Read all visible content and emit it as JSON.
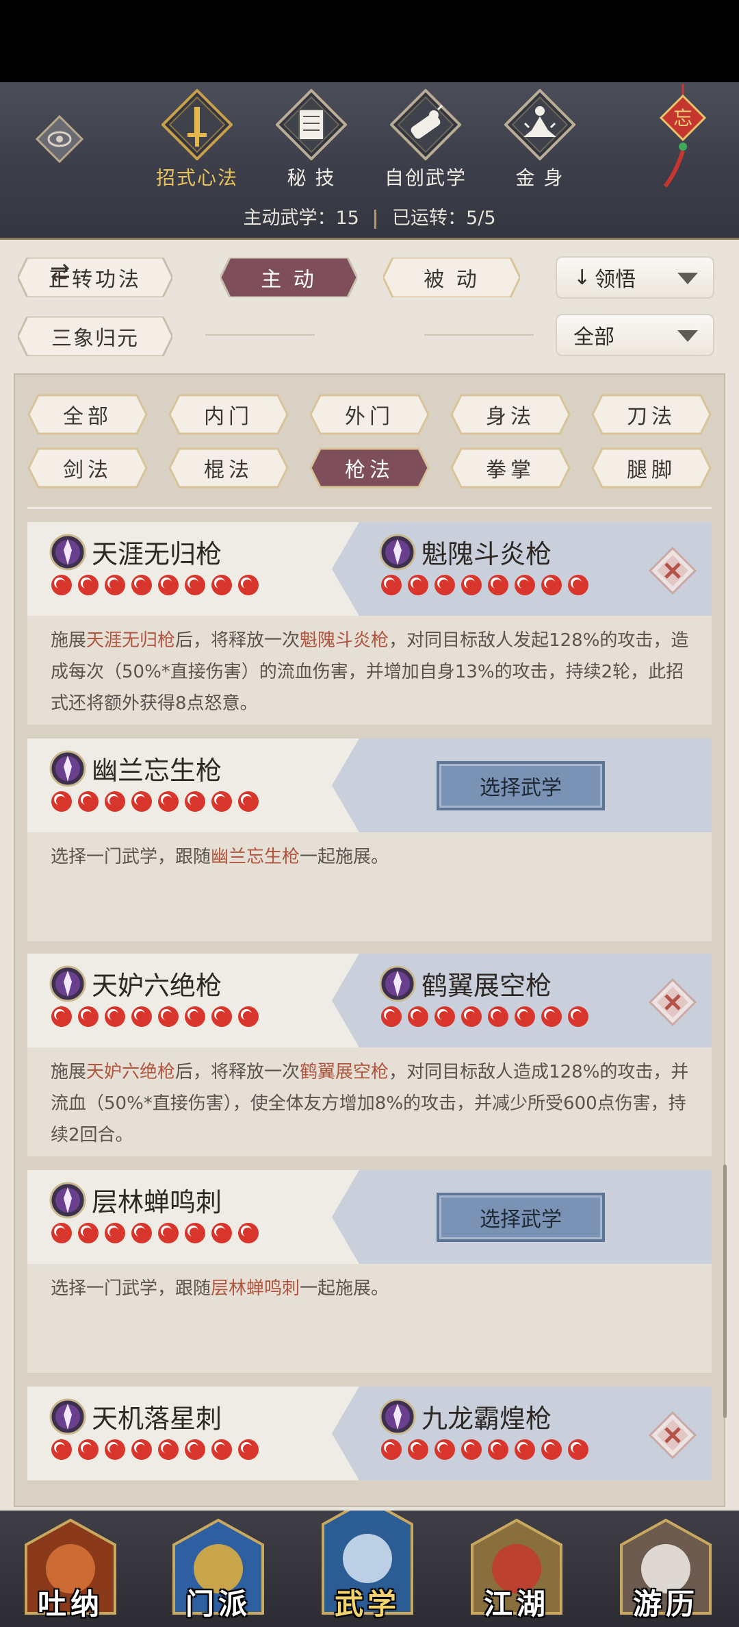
{
  "top_tabs": [
    {
      "label": "招式心法",
      "icon": "sword-icon",
      "active": true
    },
    {
      "label": "秘 技",
      "icon": "book-icon",
      "active": false
    },
    {
      "label": "自创武学",
      "icon": "scroll-icon",
      "active": false
    },
    {
      "label": "金 身",
      "icon": "meditation-icon",
      "active": false
    }
  ],
  "summary": {
    "active_label": "主动武学：15",
    "used_label": "已运转：5/5"
  },
  "filters": {
    "mode_button": "正转功法",
    "active_tab": "主 动",
    "passive_tab": "被 动",
    "sort_dropdown": "领悟",
    "sub_button": "三象归元",
    "scope_dropdown": "全部"
  },
  "types": [
    "全部",
    "内门",
    "外门",
    "身法",
    "刀法",
    "剑法",
    "棍法",
    "枪法",
    "拳掌",
    "腿脚"
  ],
  "active_type": "枪法",
  "cards": [
    {
      "left": "天涯无归枪",
      "right": "魁隗斗炎枪",
      "pips": 8,
      "desc": [
        {
          "t": "施展"
        },
        {
          "t": "天涯无归枪",
          "hl": true
        },
        {
          "t": "后，将释放一次"
        },
        {
          "t": "魁隗斗炎枪",
          "hl": true
        },
        {
          "t": "，对同目标敌人发起128%的攻击，造成每次（50%*直接伤害）的流血伤害，并增加自身13%的攻击，持续2轮，此招式还将额外获得8点怒意。"
        }
      ]
    },
    {
      "left": "幽兰忘生枪",
      "right": null,
      "pips": 8,
      "button": "选择武学",
      "desc": [
        {
          "t": "选择一门武学，跟随"
        },
        {
          "t": "幽兰忘生枪",
          "hl": true
        },
        {
          "t": "一起施展。"
        }
      ]
    },
    {
      "left": "天妒六绝枪",
      "right": "鹤翼展空枪",
      "pips": 8,
      "desc": [
        {
          "t": "施展"
        },
        {
          "t": "天妒六绝枪",
          "hl": true
        },
        {
          "t": "后，将释放一次"
        },
        {
          "t": "鹤翼展空枪",
          "hl": true
        },
        {
          "t": "，对同目标敌人造成128%的攻击，并流血（50%*直接伤害），使全体友方增加8%的攻击，并减少所受600点伤害，持续2回合。"
        }
      ]
    },
    {
      "left": "层林蝉鸣刺",
      "right": null,
      "pips": 8,
      "button": "选择武学",
      "desc": [
        {
          "t": "选择一门武学，跟随"
        },
        {
          "t": "层林蝉鸣刺",
          "hl": true
        },
        {
          "t": "一起施展。"
        }
      ]
    },
    {
      "left": "天机落星刺",
      "right": "九龙霸煌枪",
      "pips": 8,
      "desc": []
    }
  ],
  "bottom_nav": [
    {
      "label": "吐纳",
      "icon": "monk-icon"
    },
    {
      "label": "门派",
      "icon": "sect-icon"
    },
    {
      "label": "武学",
      "icon": "manual-icon",
      "active": true
    },
    {
      "label": "江湖",
      "icon": "straw-hat-icon"
    },
    {
      "label": "游历",
      "icon": "horse-icon"
    }
  ],
  "colors": {
    "accent": "#e8c25a",
    "highlight": "#b0563f",
    "active_pill": "#7e4f5a",
    "choose_button": "#7a93b4"
  }
}
